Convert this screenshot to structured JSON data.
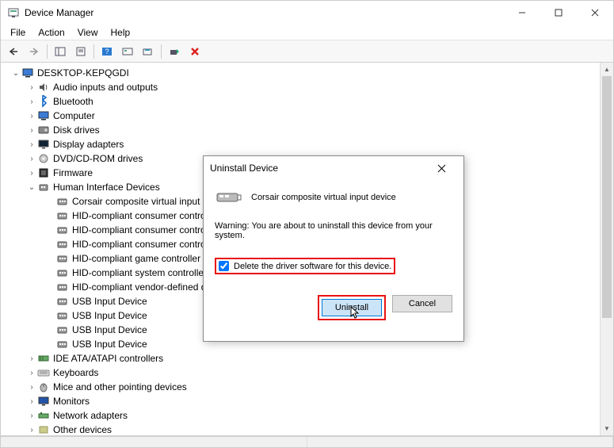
{
  "window": {
    "title": "Device Manager"
  },
  "menu": {
    "file": "File",
    "action": "Action",
    "view": "View",
    "help": "Help"
  },
  "tree": {
    "root": "DESKTOP-KEPQGDI",
    "categories": [
      {
        "label": "Audio inputs and outputs",
        "expanded": false,
        "icon": "audio"
      },
      {
        "label": "Bluetooth",
        "expanded": false,
        "icon": "bluetooth"
      },
      {
        "label": "Computer",
        "expanded": false,
        "icon": "computer"
      },
      {
        "label": "Disk drives",
        "expanded": false,
        "icon": "disk"
      },
      {
        "label": "Display adapters",
        "expanded": false,
        "icon": "display"
      },
      {
        "label": "DVD/CD-ROM drives",
        "expanded": false,
        "icon": "dvd"
      },
      {
        "label": "Firmware",
        "expanded": false,
        "icon": "firmware"
      },
      {
        "label": "Human Interface Devices",
        "expanded": true,
        "icon": "hid",
        "children": [
          "Corsair composite virtual input device",
          "HID-compliant consumer control device",
          "HID-compliant consumer control device",
          "HID-compliant consumer control device",
          "HID-compliant game controller",
          "HID-compliant system controller",
          "HID-compliant vendor-defined device",
          "USB Input Device",
          "USB Input Device",
          "USB Input Device",
          "USB Input Device"
        ]
      },
      {
        "label": "IDE ATA/ATAPI controllers",
        "expanded": false,
        "icon": "ide"
      },
      {
        "label": "Keyboards",
        "expanded": false,
        "icon": "keyboard"
      },
      {
        "label": "Mice and other pointing devices",
        "expanded": false,
        "icon": "mouse"
      },
      {
        "label": "Monitors",
        "expanded": false,
        "icon": "monitor"
      },
      {
        "label": "Network adapters",
        "expanded": false,
        "icon": "network"
      },
      {
        "label": "Other devices",
        "expanded": false,
        "icon": "other"
      }
    ]
  },
  "dialog": {
    "title": "Uninstall Device",
    "device_name": "Corsair composite virtual input device",
    "warning": "Warning: You are about to uninstall this device from your system.",
    "checkbox_label": "Delete the driver software for this device.",
    "checkbox_checked": true,
    "uninstall_label": "Uninstall",
    "cancel_label": "Cancel"
  }
}
